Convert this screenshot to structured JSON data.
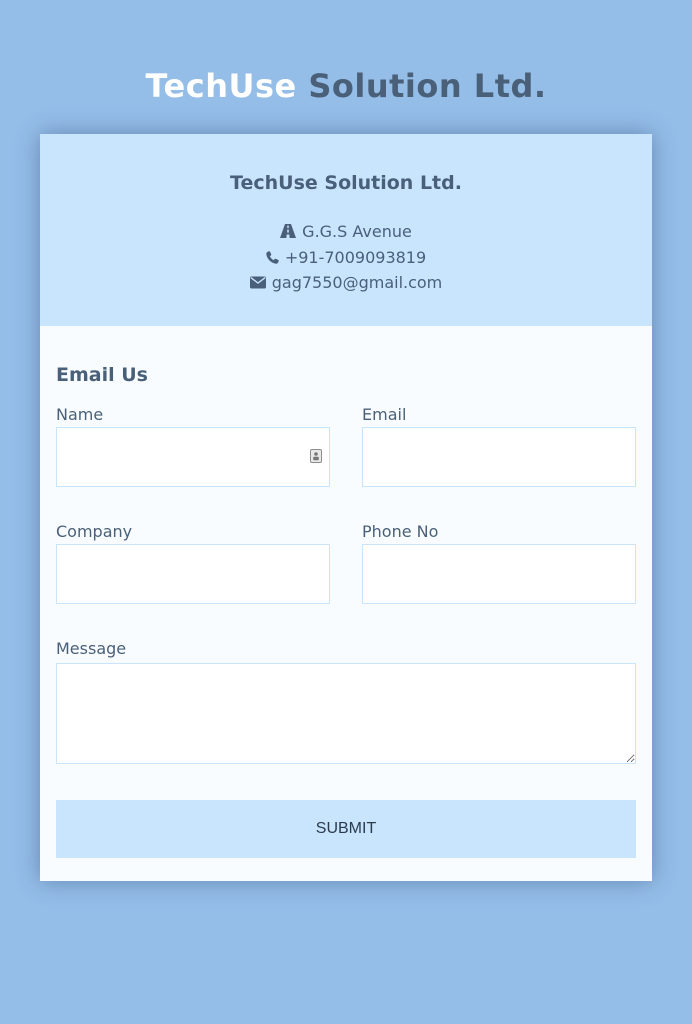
{
  "brand": {
    "part1": "TechUse",
    "part2": "Solution Ltd."
  },
  "company": {
    "name": "TechUse Solution Ltd.",
    "address": "G.G.S Avenue",
    "phone": "+91-7009093819",
    "email": "gag7550@gmail.com",
    "icons": [
      "road-icon",
      "phone-icon",
      "envelope-icon"
    ]
  },
  "form": {
    "title": "Email Us",
    "name_label": "Name",
    "name_value": "",
    "email_label": "Email",
    "email_value": "",
    "company_label": "Company",
    "company_value": "",
    "phone_label": "Phone No",
    "phone_value": "",
    "message_label": "Message",
    "message_value": "",
    "submit_label": "SUBMIT"
  },
  "colors": {
    "page_background": "#94bde8",
    "accent_light": "#c9e5fd",
    "text": "#4a6079"
  }
}
